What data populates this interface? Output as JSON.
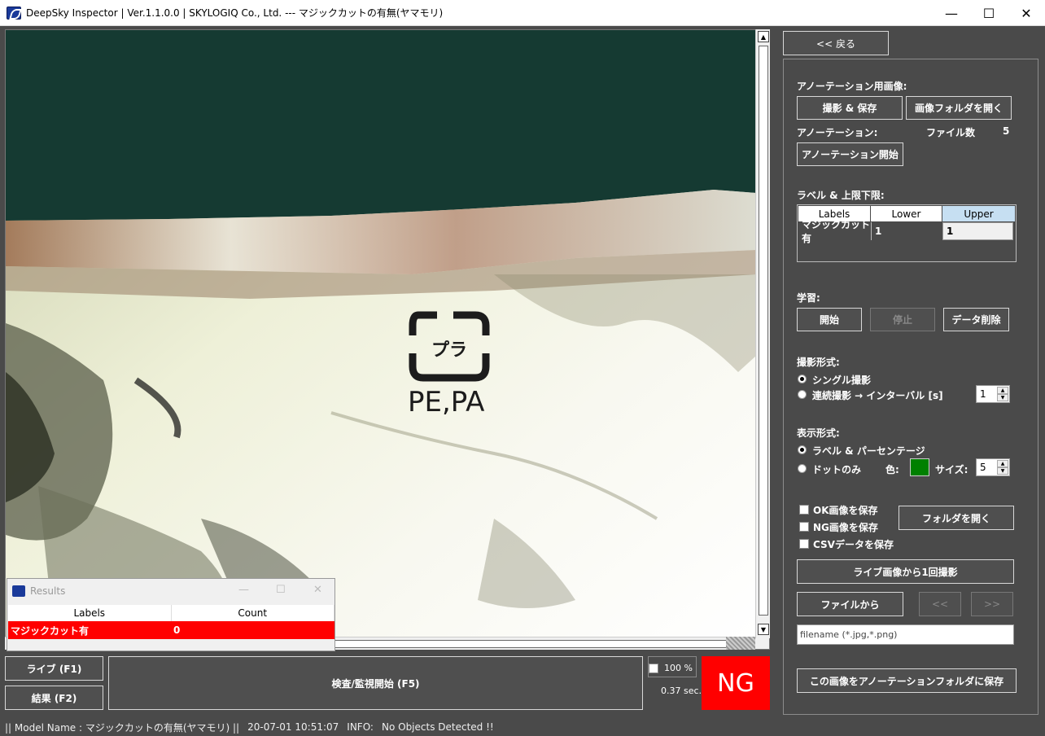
{
  "window": {
    "title": "DeepSky Inspector | Ver.1.1.0.0 | SKYLOGIQ Co., Ltd. --- マジックカットの有無(ヤマモリ)",
    "minimize": "—",
    "maximize": "☐",
    "close": "✕"
  },
  "image_view": {
    "package_text": "PE,PA",
    "recycle_mark_text": "プラ"
  },
  "results_window": {
    "title": "Results",
    "columns": [
      "Labels",
      "Count"
    ],
    "rows": [
      {
        "label": "マジックカット有",
        "count": "0"
      }
    ]
  },
  "controls": {
    "live_button": "ライブ (F1)",
    "result_button": "結果 (F2)",
    "inspect_button": "検査/監視開始 (F5)",
    "zoom_label": "100 %",
    "time_label": "0.37 sec.",
    "status_indicator": "NG",
    "status_color": "#ff0000"
  },
  "panel": {
    "back_button": "<< 戻る",
    "annotation_image_heading": "アノーテーション用画像:",
    "capture_save_button": "撮影 & 保存",
    "open_image_folder_button": "画像フォルダを開く",
    "annotation_heading": "アノーテーション:",
    "file_count_label": "ファイル数",
    "file_count_value": "5",
    "start_annotation_button": "アノーテーション開始",
    "label_limits_heading": "ラベル & 上限下限:",
    "limits_table": {
      "columns": [
        "Labels",
        "Lower",
        "Upper"
      ],
      "rows": [
        {
          "label": "マジックカット有",
          "lower": "1",
          "upper": "1"
        }
      ]
    },
    "learning_heading": "学習:",
    "learn_start_button": "開始",
    "learn_stop_button": "停止",
    "delete_data_button": "データ削除",
    "capture_mode_heading": "撮影形式:",
    "single_capture_option": "シングル撮影",
    "continuous_capture_option": "連続撮影 → インターバル [s]",
    "interval_value": "1",
    "display_mode_heading": "表示形式:",
    "label_percent_option": "ラベル & パーセンテージ",
    "dots_only_option": "ドットのみ",
    "color_label": "色:",
    "dot_color": "#008000",
    "size_label": "サイズ:",
    "size_value": "5",
    "save_ok_checkbox": "OK画像を保存",
    "save_ng_checkbox": "NG画像を保存",
    "save_csv_checkbox": "CSVデータを保存",
    "open_folder_button": "フォルダを開く",
    "capture_once_button": "ライブ画像から1回撮影",
    "from_file_button": "ファイルから",
    "prev_button": "<<",
    "next_button": ">>",
    "filename_placeholder": "filename (*.jpg,*.png)",
    "save_to_annotation_button": "この画像をアノーテーションフォルダに保存"
  },
  "statusbar": {
    "model": "|| Model Name : マジックカットの有無(ヤマモリ) ||",
    "datetime": "20-07-01 10:51:07",
    "info_label": "INFO:",
    "info_text": "No Objects Detected !!"
  }
}
